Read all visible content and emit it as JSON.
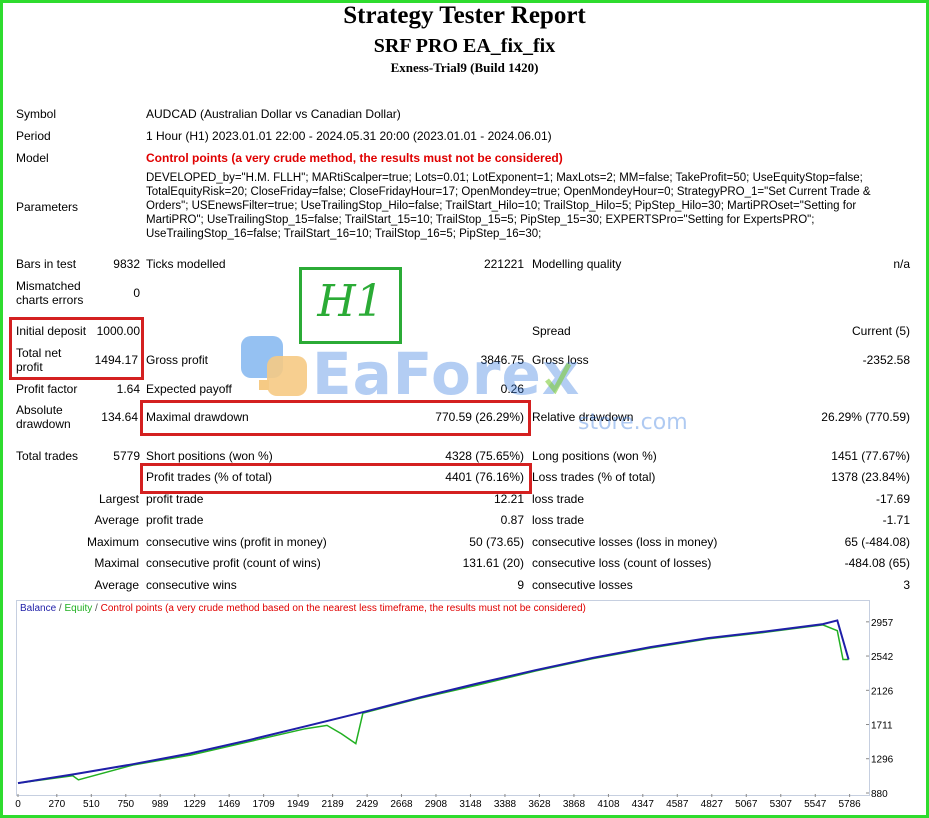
{
  "header": {
    "title": "Strategy Tester Report",
    "subtitle": "SRF PRO EA_fix_fix",
    "server": "Exness-Trial9 (Build 1420)"
  },
  "info": {
    "symbol_label": "Symbol",
    "symbol_value": "AUDCAD (Australian Dollar vs Canadian Dollar)",
    "period_label": "Period",
    "period_value": "1 Hour (H1) 2023.01.01 22:00 - 2024.05.31 20:00 (2023.01.01 - 2024.06.01)",
    "model_label": "Model",
    "model_value": "Control points (a very crude method, the results must not be considered)",
    "parameters_label": "Parameters",
    "parameters_value": "DEVELOPED_by=\"H.M. FLLH\"; MARtiScalper=true; Lots=0.01; LotExponent=1; MaxLots=2; MM=false; TakeProfit=50; UseEquityStop=false; TotalEquityRisk=20; CloseFriday=false; CloseFridayHour=17; OpenMondey=true; OpenMondeyHour=0; StrategyPRO_1=\"Set Current Trade & Orders\"; USEnewsFilter=true; UseTrailingStop_Hilo=false; TrailStart_Hilo=10; TrailStop_Hilo=5; PipStep_Hilo=30; MartiPROset=\"Setting for MartiPRO\"; UseTrailingStop_15=false; TrailStart_15=10; TrailStop_15=5; PipStep_15=30; EXPERTSPro=\"Setting for ExpertsPRO\"; UseTrailingStop_16=false; TrailStart_16=10; TrailStop_16=5; PipStep_16=30;"
  },
  "stats": {
    "bars_label": "Bars in test",
    "bars_value": "9832",
    "ticks_label": "Ticks modelled",
    "ticks_value": "221221",
    "quality_label": "Modelling quality",
    "quality_value": "n/a",
    "mismatch_label": "Mismatched charts errors",
    "mismatch_value": "0",
    "initial_label": "Initial deposit",
    "initial_value": "1000.00",
    "spread_label": "Spread",
    "spread_value": "Current (5)",
    "netprofit_label": "Total net profit",
    "netprofit_value": "1494.17",
    "grossprofit_label": "Gross profit",
    "grossprofit_value": "3846.75",
    "grossloss_label": "Gross loss",
    "grossloss_value": "-2352.58",
    "pf_label": "Profit factor",
    "pf_value": "1.64",
    "payoff_label": "Expected payoff",
    "payoff_value": "0.26",
    "absdd_label": "Absolute drawdown",
    "absdd_value": "134.64",
    "maxdd_label": "Maximal drawdown",
    "maxdd_value": "770.59 (26.29%)",
    "reldd_label": "Relative drawdown",
    "reldd_value": "26.29% (770.59)",
    "trades_label": "Total trades",
    "trades_value": "5779",
    "short_label": "Short positions (won %)",
    "short_value": "4328 (75.65%)",
    "long_label": "Long positions (won %)",
    "long_value": "1451 (77.67%)",
    "ptrades_label": "Profit trades (% of total)",
    "ptrades_value": "4401 (76.16%)",
    "ltrades_label": "Loss trades (% of total)",
    "ltrades_value": "1378 (23.84%)",
    "largest": "Largest",
    "profit_trade": "profit trade",
    "largest_profit": "12.21",
    "loss_trade": "loss trade",
    "largest_loss": "-17.69",
    "average": "Average",
    "average_profit": "0.87",
    "average_loss": "-1.71",
    "maximum": "Maximum",
    "cw_money_label": "consecutive wins (profit in money)",
    "cw_money_value": "50 (73.65)",
    "cl_money_label": "consecutive losses (loss in money)",
    "cl_money_value": "65 (-484.08)",
    "maximal": "Maximal",
    "cp_count_label": "consecutive profit (count of wins)",
    "cp_count_value": "131.61 (20)",
    "cl_count_label": "consecutive loss (count of losses)",
    "cl_count_value": "-484.08 (65)",
    "average2": "Average",
    "cwins_label": "consecutive wins",
    "cwins_value": "9",
    "closses_label": "consecutive losses",
    "closses_value": "3"
  },
  "watermark": {
    "badge": "H1",
    "brand_part1": "Ea",
    "brand_part2": "Forex",
    "brand_sub": "store.com"
  },
  "chart_data": {
    "type": "line",
    "legend": {
      "balance": "Balance",
      "sep1": " / ",
      "equity": "Equity",
      "sep2": " / ",
      "note": "Control points (a very crude method based on the nearest less timeframe, the results must not be considered)"
    },
    "x_ticks": [
      "0",
      "270",
      "510",
      "750",
      "989",
      "1229",
      "1469",
      "1709",
      "1949",
      "2189",
      "2429",
      "2668",
      "2908",
      "3148",
      "3388",
      "3628",
      "3868",
      "4108",
      "4347",
      "4587",
      "4827",
      "5067",
      "5307",
      "5547",
      "5786"
    ],
    "y_ticks": [
      "2957",
      "2542",
      "2126",
      "1711",
      "1296",
      "880"
    ],
    "xlim": [
      0,
      5900
    ],
    "ylim": [
      880,
      3040
    ],
    "series": [
      {
        "name": "Balance",
        "color": "#1f1fa8",
        "x": [
          0,
          400,
          800,
          1200,
          1600,
          2000,
          2400,
          2800,
          3200,
          3600,
          4000,
          4400,
          4800,
          5200,
          5600,
          5700,
          5779
        ],
        "y": [
          1000,
          1110,
          1230,
          1360,
          1520,
          1690,
          1860,
          2040,
          2210,
          2370,
          2520,
          2650,
          2760,
          2840,
          2930,
          2975,
          2500
        ]
      },
      {
        "name": "Equity",
        "color": "#22b022",
        "x": [
          0,
          380,
          420,
          800,
          1200,
          1600,
          2000,
          2150,
          2250,
          2350,
          2400,
          2800,
          3200,
          3600,
          4000,
          4400,
          4800,
          5200,
          5600,
          5700,
          5740,
          5779
        ],
        "y": [
          1000,
          1090,
          1040,
          1220,
          1340,
          1500,
          1660,
          1700,
          1600,
          1480,
          1850,
          2030,
          2190,
          2360,
          2510,
          2640,
          2750,
          2830,
          2920,
          2850,
          2500,
          2500
        ]
      }
    ],
    "colors": {
      "balance": "#1f1fa8",
      "equity": "#22b022",
      "note": "#e00000",
      "frame": "#c6cfe0"
    }
  }
}
